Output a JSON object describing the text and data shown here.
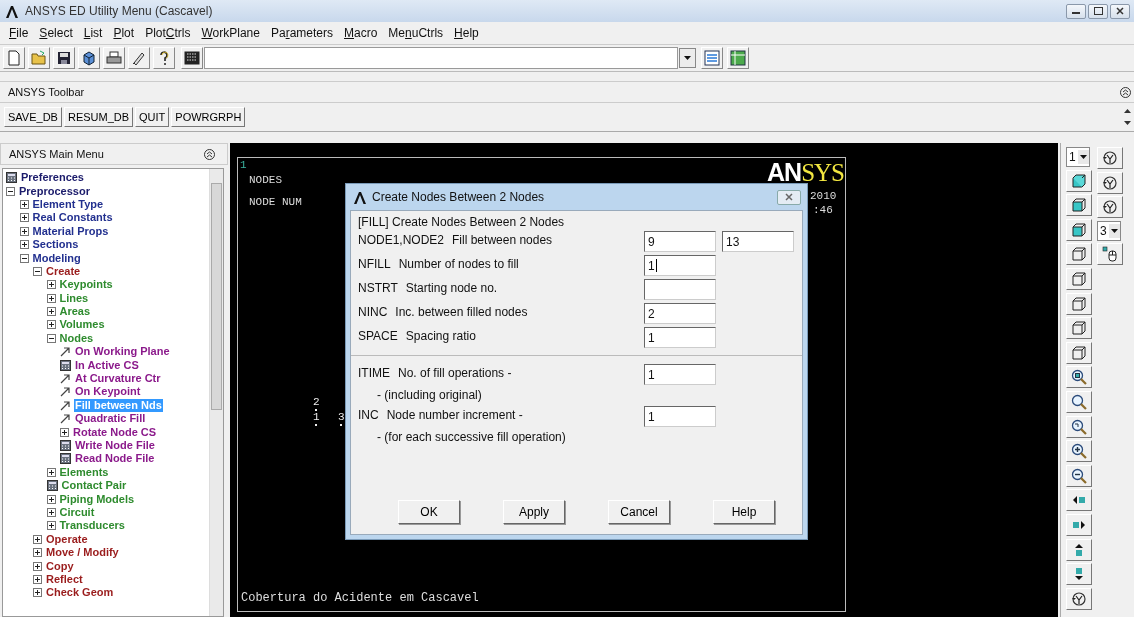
{
  "window": {
    "title": "ANSYS ED Utility Menu (Cascavel)"
  },
  "menu_bar": [
    {
      "key": "F",
      "post": "ile"
    },
    {
      "key": "S",
      "post": "elect"
    },
    {
      "key": "L",
      "post": "ist"
    },
    {
      "key": "P",
      "post": "lot"
    },
    {
      "pre": "Plot",
      "key": "C",
      "post": "trls"
    },
    {
      "key": "W",
      "post": "orkPlane"
    },
    {
      "pre": "Pa",
      "key": "r",
      "post": "ameters"
    },
    {
      "key": "M",
      "post": "acro"
    },
    {
      "pre": "Me",
      "key": "n",
      "post": "uCtrls"
    },
    {
      "key": "H",
      "post": "elp"
    }
  ],
  "toolbar": {
    "title": "ANSYS Toolbar",
    "buttons": [
      "SAVE_DB",
      "RESUM_DB",
      "QUIT",
      "POWRGRPH"
    ]
  },
  "main_menu": {
    "title": "ANSYS Main Menu",
    "items": [
      {
        "label": "Preferences",
        "kind": "dialog",
        "selected": false
      },
      {
        "label": "Preprocessor",
        "kind": "branch",
        "expanded": true,
        "selected": false,
        "children": [
          {
            "label": "Element Type",
            "kind": "branch",
            "expanded": false,
            "selected": false
          },
          {
            "label": "Real Constants",
            "kind": "branch",
            "expanded": false,
            "selected": false
          },
          {
            "label": "Material Props",
            "kind": "branch",
            "expanded": false,
            "selected": false
          },
          {
            "label": "Sections",
            "kind": "branch",
            "expanded": false,
            "selected": false
          },
          {
            "label": "Modeling",
            "kind": "branch",
            "expanded": true,
            "selected": false,
            "children": [
              {
                "label": "Create",
                "kind": "branch",
                "expanded": true,
                "selected": false,
                "children": [
                  {
                    "label": "Keypoints",
                    "kind": "branch",
                    "expanded": false,
                    "selected": false
                  },
                  {
                    "label": "Lines",
                    "kind": "branch",
                    "expanded": false,
                    "selected": false
                  },
                  {
                    "label": "Areas",
                    "kind": "branch",
                    "expanded": false,
                    "selected": false
                  },
                  {
                    "label": "Volumes",
                    "kind": "branch",
                    "expanded": false,
                    "selected": false
                  },
                  {
                    "label": "Nodes",
                    "kind": "branch",
                    "expanded": true,
                    "selected": false,
                    "children": [
                      {
                        "label": "On Working Plane",
                        "kind": "pick",
                        "selected": false
                      },
                      {
                        "label": "In Active CS",
                        "kind": "dialog",
                        "selected": false
                      },
                      {
                        "label": "At Curvature Ctr",
                        "kind": "pick",
                        "selected": false
                      },
                      {
                        "label": "On Keypoint",
                        "kind": "pick",
                        "selected": false
                      },
                      {
                        "label": "Fill between Nds",
                        "kind": "pick",
                        "selected": true
                      },
                      {
                        "label": "Quadratic Fill",
                        "kind": "pick",
                        "selected": false
                      },
                      {
                        "label": "Rotate Node CS",
                        "kind": "branch",
                        "expanded": false,
                        "selected": false
                      },
                      {
                        "label": "Write Node File",
                        "kind": "dialog",
                        "selected": false
                      },
                      {
                        "label": "Read Node File",
                        "kind": "dialog",
                        "selected": false
                      }
                    ]
                  },
                  {
                    "label": "Elements",
                    "kind": "branch",
                    "expanded": false,
                    "selected": false
                  },
                  {
                    "label": "Contact Pair",
                    "kind": "dialog",
                    "selected": false
                  },
                  {
                    "label": "Piping Models",
                    "kind": "branch",
                    "expanded": false,
                    "selected": false
                  },
                  {
                    "label": "Circuit",
                    "kind": "branch",
                    "expanded": false,
                    "selected": false
                  },
                  {
                    "label": "Transducers",
                    "kind": "branch",
                    "expanded": false,
                    "selected": false
                  }
                ]
              },
              {
                "label": "Operate",
                "kind": "branch",
                "expanded": false,
                "selected": false
              },
              {
                "label": "Move / Modify",
                "kind": "branch",
                "expanded": false,
                "selected": false
              },
              {
                "label": "Copy",
                "kind": "branch",
                "expanded": false,
                "selected": false
              },
              {
                "label": "Reflect",
                "kind": "branch",
                "expanded": false,
                "selected": false
              },
              {
                "label": "Check Geom",
                "kind": "branch",
                "expanded": false,
                "selected": false
              }
            ]
          }
        ]
      }
    ]
  },
  "graphics": {
    "window_number": "1",
    "lines": [
      "NODES",
      "NODE NUM"
    ],
    "logo_parts": [
      "AN",
      "SYS"
    ],
    "date": "2010",
    "time": ":46",
    "nodes": [
      {
        "label": "2"
      },
      {
        "label": "1"
      },
      {
        "label": "3"
      }
    ],
    "caption": "Cobertura do Acidente em Cascavel"
  },
  "dialog": {
    "title": "Create Nodes Between 2 Nodes",
    "heading": "[FILL]  Create Nodes Between 2 Nodes",
    "rows": [
      {
        "kind": "field",
        "code": "NODE1,NODE2",
        "label": "Fill between nodes",
        "fields": [
          {
            "value": "9",
            "focused": false
          },
          {
            "value": "13",
            "focused": false
          }
        ]
      },
      {
        "kind": "field",
        "code": "NFILL",
        "label": "Number of nodes to fill",
        "fields": [
          {
            "value": "1",
            "focused": true
          }
        ]
      },
      {
        "kind": "field",
        "code": "NSTRT",
        "label": "Starting node no.",
        "fields": [
          {
            "focused": false
          }
        ]
      },
      {
        "kind": "field",
        "code": "NINC",
        "label": "Inc. between filled nodes",
        "fields": [
          {
            "value": "2",
            "focused": false
          }
        ]
      },
      {
        "kind": "field",
        "code": "SPACE",
        "label": "Spacing ratio",
        "fields": [
          {
            "value": "1",
            "focused": false
          }
        ]
      },
      {
        "kind": "divider"
      },
      {
        "kind": "field",
        "code": "ITIME",
        "label": "No. of fill operations -",
        "fields": [
          {
            "value": "1",
            "focused": false
          }
        ]
      },
      {
        "kind": "note",
        "text": "- (including original)"
      },
      {
        "kind": "field",
        "code": "INC",
        "label": "Node number increment -",
        "fields": [
          {
            "value": "1",
            "focused": false
          }
        ]
      },
      {
        "kind": "note",
        "text": "- (for each successive fill operation)"
      }
    ],
    "buttons": [
      "OK",
      "Apply",
      "Cancel",
      "Help"
    ]
  },
  "view_toolbar": {
    "window_dropdown": "1",
    "increment_dropdown": "3"
  }
}
